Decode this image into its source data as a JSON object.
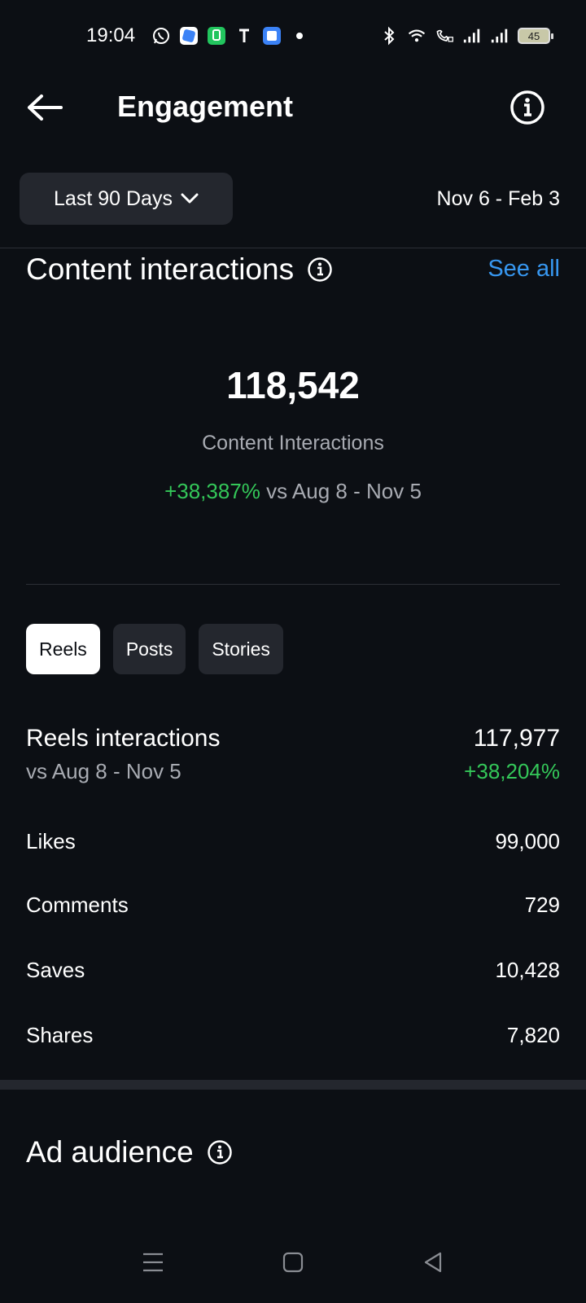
{
  "status_bar": {
    "time": "19:04",
    "battery": "45",
    "left_icons": [
      "whatsapp-icon",
      "app-icon-blue",
      "app-icon-green",
      "t-icon",
      "app-icon-square",
      "dot-icon"
    ],
    "right_icons": [
      "bluetooth-icon",
      "wifi-icon",
      "wifi-call-icon",
      "signal-icon",
      "signal-icon"
    ]
  },
  "header": {
    "title": "Engagement",
    "back_icon": "arrow-left-icon",
    "info_icon": "info-icon"
  },
  "filter": {
    "range_label": "Last 90 Days",
    "date_range": "Nov 6 - Feb 3"
  },
  "content_interactions": {
    "title": "Content interactions",
    "see_all": "See all",
    "total": "118,542",
    "label": "Content Interactions",
    "change": "+38,387%",
    "compare_text": "vs Aug 8 - Nov 5"
  },
  "tabs": [
    {
      "label": "Reels",
      "active": true
    },
    {
      "label": "Posts",
      "active": false
    },
    {
      "label": "Stories",
      "active": false
    }
  ],
  "reels": {
    "title": "Reels interactions",
    "compare_text": "vs Aug 8 - Nov 5",
    "total": "117,977",
    "change": "+38,204%",
    "metrics": [
      {
        "label": "Likes",
        "value": "99,000"
      },
      {
        "label": "Comments",
        "value": "729"
      },
      {
        "label": "Saves",
        "value": "10,428"
      },
      {
        "label": "Shares",
        "value": "7,820"
      }
    ]
  },
  "ad_audience": {
    "title": "Ad audience"
  },
  "colors": {
    "background": "#0c0f14",
    "accent_link": "#3797f0",
    "positive": "#34c759",
    "muted_text": "#a8abb2",
    "chip_bg": "#24272e"
  }
}
